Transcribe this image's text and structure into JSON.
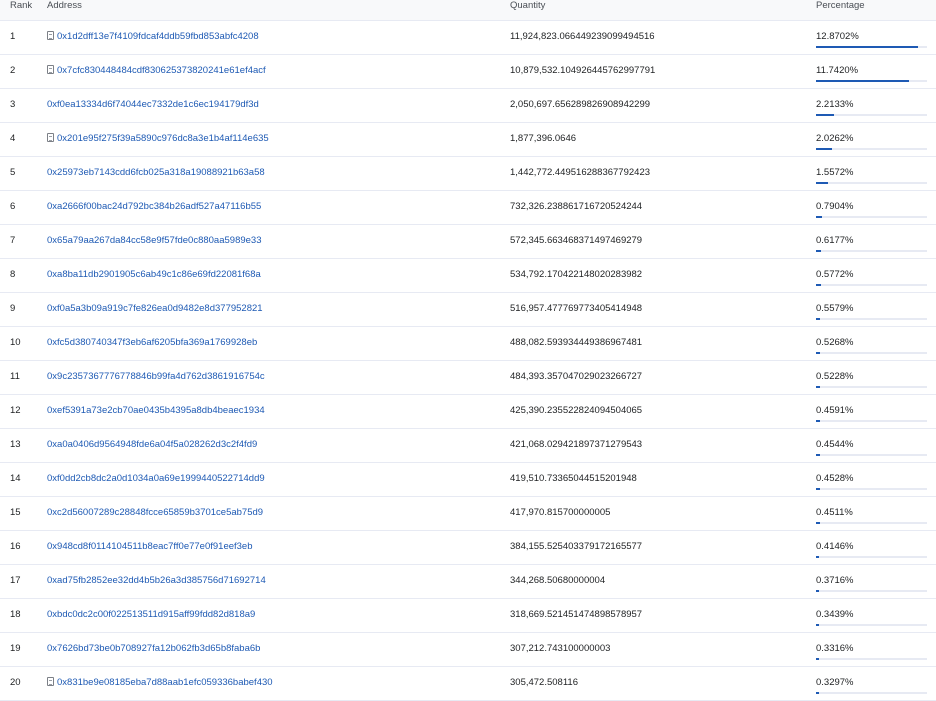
{
  "columns": {
    "rank": "Rank",
    "address": "Address",
    "quantity": "Quantity",
    "percentage": "Percentage"
  },
  "colors": {
    "link": "#1e5ab4",
    "bar": "#1e5ab4",
    "track": "#e7eaf3"
  },
  "rows": [
    {
      "rank": "1",
      "address": "0x1d2dff13e7f4109fdcaf4ddb59fbd853abfc4208",
      "contract": true,
      "quantity": "11,924,823.066449239099494516",
      "percentage": "12.8702%",
      "share": 0.128702
    },
    {
      "rank": "2",
      "address": "0x7cfc830448484cdf830625373820241e61ef4acf",
      "contract": true,
      "quantity": "10,879,532.104926445762997791",
      "percentage": "11.7420%",
      "share": 0.11742
    },
    {
      "rank": "3",
      "address": "0xf0ea13334d6f74044ec7332de1c6ec194179df3d",
      "contract": false,
      "quantity": "2,050,697.656289826908942299",
      "percentage": "2.2133%",
      "share": 0.022133
    },
    {
      "rank": "4",
      "address": "0x201e95f275f39a5890c976dc8a3e1b4af114e635",
      "contract": true,
      "quantity": "1,877,396.0646",
      "percentage": "2.0262%",
      "share": 0.020262
    },
    {
      "rank": "5",
      "address": "0x25973eb7143cdd6fcb025a318a19088921b63a58",
      "contract": false,
      "quantity": "1,442,772.449516288367792423",
      "percentage": "1.5572%",
      "share": 0.015572
    },
    {
      "rank": "6",
      "address": "0xa2666f00bac24d792bc384b26adf527a47116b55",
      "contract": false,
      "quantity": "732,326.238861716720524244",
      "percentage": "0.7904%",
      "share": 0.007904
    },
    {
      "rank": "7",
      "address": "0x65a79aa267da84cc58e9f57fde0c880aa5989e33",
      "contract": false,
      "quantity": "572,345.663468371497469279",
      "percentage": "0.6177%",
      "share": 0.006177
    },
    {
      "rank": "8",
      "address": "0xa8ba11db2901905c6ab49c1c86e69fd22081f68a",
      "contract": false,
      "quantity": "534,792.170422148020283982",
      "percentage": "0.5772%",
      "share": 0.005772
    },
    {
      "rank": "9",
      "address": "0xf0a5a3b09a919c7fe826ea0d9482e8d377952821",
      "contract": false,
      "quantity": "516,957.477769773405414948",
      "percentage": "0.5579%",
      "share": 0.005579
    },
    {
      "rank": "10",
      "address": "0xfc5d380740347f3eb6af6205bfa369a1769928eb",
      "contract": false,
      "quantity": "488,082.593934449386967481",
      "percentage": "0.5268%",
      "share": 0.005268
    },
    {
      "rank": "11",
      "address": "0x9c2357367776778846b99fa4d762d3861916754c",
      "contract": false,
      "quantity": "484,393.357047029023266727",
      "percentage": "0.5228%",
      "share": 0.005228
    },
    {
      "rank": "12",
      "address": "0xef5391a73e2cb70ae0435b4395a8db4beaec1934",
      "contract": false,
      "quantity": "425,390.235522824094504065",
      "percentage": "0.4591%",
      "share": 0.004591
    },
    {
      "rank": "13",
      "address": "0xa0a0406d9564948fde6a04f5a028262d3c2f4fd9",
      "contract": false,
      "quantity": "421,068.029421897371279543",
      "percentage": "0.4544%",
      "share": 0.004544
    },
    {
      "rank": "14",
      "address": "0xf0dd2cb8dc2a0d1034a0a69e1999440522714dd9",
      "contract": false,
      "quantity": "419,510.73365044515201948",
      "percentage": "0.4528%",
      "share": 0.004528
    },
    {
      "rank": "15",
      "address": "0xc2d56007289c28848fcce65859b3701ce5ab75d9",
      "contract": false,
      "quantity": "417,970.815700000005",
      "percentage": "0.4511%",
      "share": 0.004511
    },
    {
      "rank": "16",
      "address": "0x948cd8f0114104511b8eac7ff0e77e0f91eef3eb",
      "contract": false,
      "quantity": "384,155.525403379172165577",
      "percentage": "0.4146%",
      "share": 0.004146
    },
    {
      "rank": "17",
      "address": "0xad75fb2852ee32dd4b5b26a3d385756d71692714",
      "contract": false,
      "quantity": "344,268.50680000004",
      "percentage": "0.3716%",
      "share": 0.003716
    },
    {
      "rank": "18",
      "address": "0xbdc0dc2c00f022513511d915aff99fdd82d818a9",
      "contract": false,
      "quantity": "318,669.521451474898578957",
      "percentage": "0.3439%",
      "share": 0.003439
    },
    {
      "rank": "19",
      "address": "0x7626bd73be0b708927fa12b062fb3d65b8faba6b",
      "contract": false,
      "quantity": "307,212.743100000003",
      "percentage": "0.3316%",
      "share": 0.003316
    },
    {
      "rank": "20",
      "address": "0x831be9e08185eba7d88aab1efc059336babef430",
      "contract": true,
      "quantity": "305,472.508116",
      "percentage": "0.3297%",
      "share": 0.003297
    }
  ]
}
